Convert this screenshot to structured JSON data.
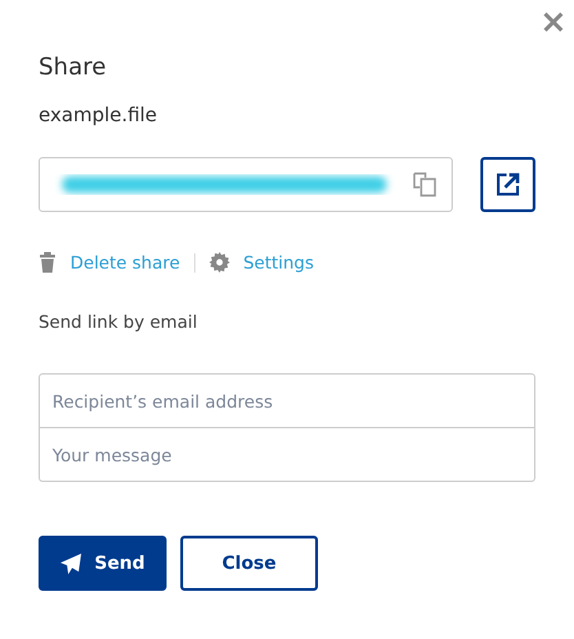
{
  "dialog": {
    "title": "Share",
    "file_name": "example.file"
  },
  "actions": [
    {
      "kind": "delete",
      "label": "Delete share"
    },
    {
      "kind": "settings",
      "label": "Settings"
    }
  ],
  "email_section": {
    "heading": "Send link by email",
    "recipient": {
      "placeholder": "Recipient’s email address"
    },
    "message": {
      "placeholder": "Your message"
    }
  },
  "buttons": [
    {
      "kind": "primary",
      "label": "Send"
    },
    {
      "kind": "secondary",
      "label": "Close"
    }
  ]
}
